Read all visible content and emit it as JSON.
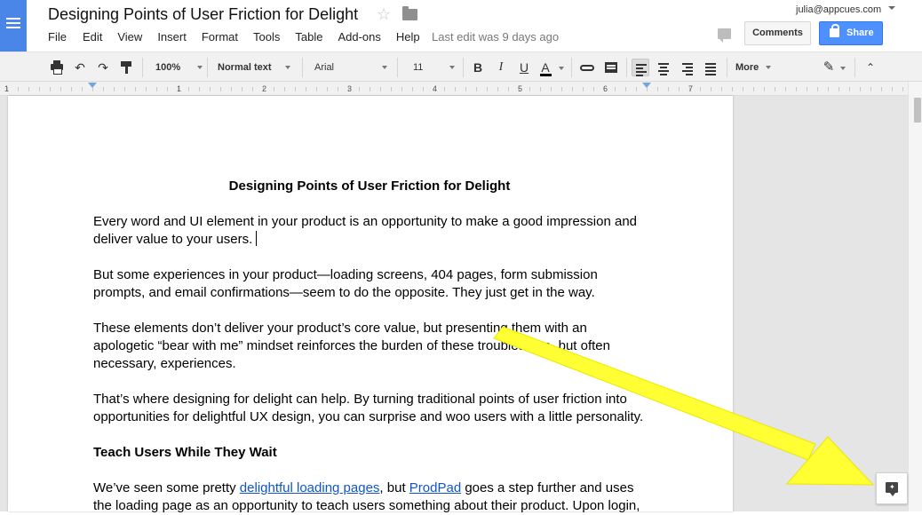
{
  "header": {
    "title": "Designing Points of User Friction for Delight",
    "menu": [
      "File",
      "Edit",
      "View",
      "Insert",
      "Format",
      "Tools",
      "Table",
      "Add-ons",
      "Help"
    ],
    "last_edit": "Last edit was 9 days ago",
    "account": "julia@appcues.com",
    "comments_label": "Comments",
    "share_label": "Share"
  },
  "toolbar": {
    "zoom": "100%",
    "style": "Normal text",
    "font": "Arial",
    "size": "11",
    "more": "More",
    "bold": "B",
    "italic": "I",
    "underline": "U",
    "text_color": "A"
  },
  "ruler": {
    "labels": [
      "1",
      "1",
      "2",
      "3",
      "4",
      "5",
      "6",
      "7"
    ]
  },
  "document": {
    "title": "Designing Points of User Friction for Delight",
    "paragraphs": [
      [
        "Every word and UI element in your product is an opportunity to make a good impression and",
        "deliver value to your users."
      ],
      [
        "But some experiences in your product—loading screens, 404 pages, form submission",
        "prompts, and email confirmations—seem to do the opposite. They just get in the way."
      ],
      [
        "These elements don’t deliver your product’s core value, but presenting them with an",
        "apologetic “bear with me” mindset reinforces the burden of these troublesome, but often",
        "necessary, experiences."
      ],
      [
        "That’s where designing for delight can help. By turning traditional points of user friction into",
        "opportunities for delightful UX design, you can surprise and woo users with a little personality."
      ]
    ],
    "section_heading": "Teach Users While They Wait",
    "last_para": {
      "prefix": "We’ve seen some pretty ",
      "link1": "delightful loading pages",
      "mid": ", but ",
      "link2": "ProdPad",
      "suffix": " goes a step further and uses",
      "line2": "the loading page as an opportunity to teach users something about their product. Upon login,"
    }
  },
  "colors": {
    "brand_blue": "#4a86e8",
    "share_blue": "#4d90fe",
    "link_blue": "#1155cc",
    "annotation_yellow": "#ffff33"
  },
  "icons": [
    "docs-logo-icon",
    "star-icon",
    "folder-icon",
    "chat-icon",
    "lock-icon",
    "print-icon",
    "undo-icon",
    "redo-icon",
    "paint-format-icon",
    "link-icon",
    "insert-comment-icon",
    "align-left-icon",
    "align-center-icon",
    "align-right-icon",
    "align-justify-icon",
    "pen-icon",
    "collapse-icon",
    "explore-icon"
  ]
}
